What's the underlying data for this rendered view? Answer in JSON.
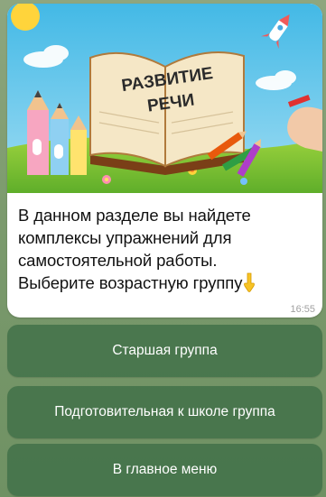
{
  "message": {
    "banner_title_line1": "РАЗВИТИЕ",
    "banner_title_line2": "РЕЧИ",
    "text_lines": [
      "В данном разделе вы найдете",
      "комплексы упражнений для",
      "самостоятельной работы.",
      "Выберите возрастную группу"
    ],
    "emoji": "pointing-down-hand",
    "time": "16:55"
  },
  "keyboard": {
    "buttons": [
      {
        "label": "Старшая группа"
      },
      {
        "label": "Подготовительная к школе группа"
      },
      {
        "label": "В главное меню"
      }
    ]
  },
  "colors": {
    "chat_background": "#7d9c72",
    "bubble": "#ffffff",
    "keyboard_button": "#3e6e46",
    "timestamp": "#a0a0a0"
  }
}
